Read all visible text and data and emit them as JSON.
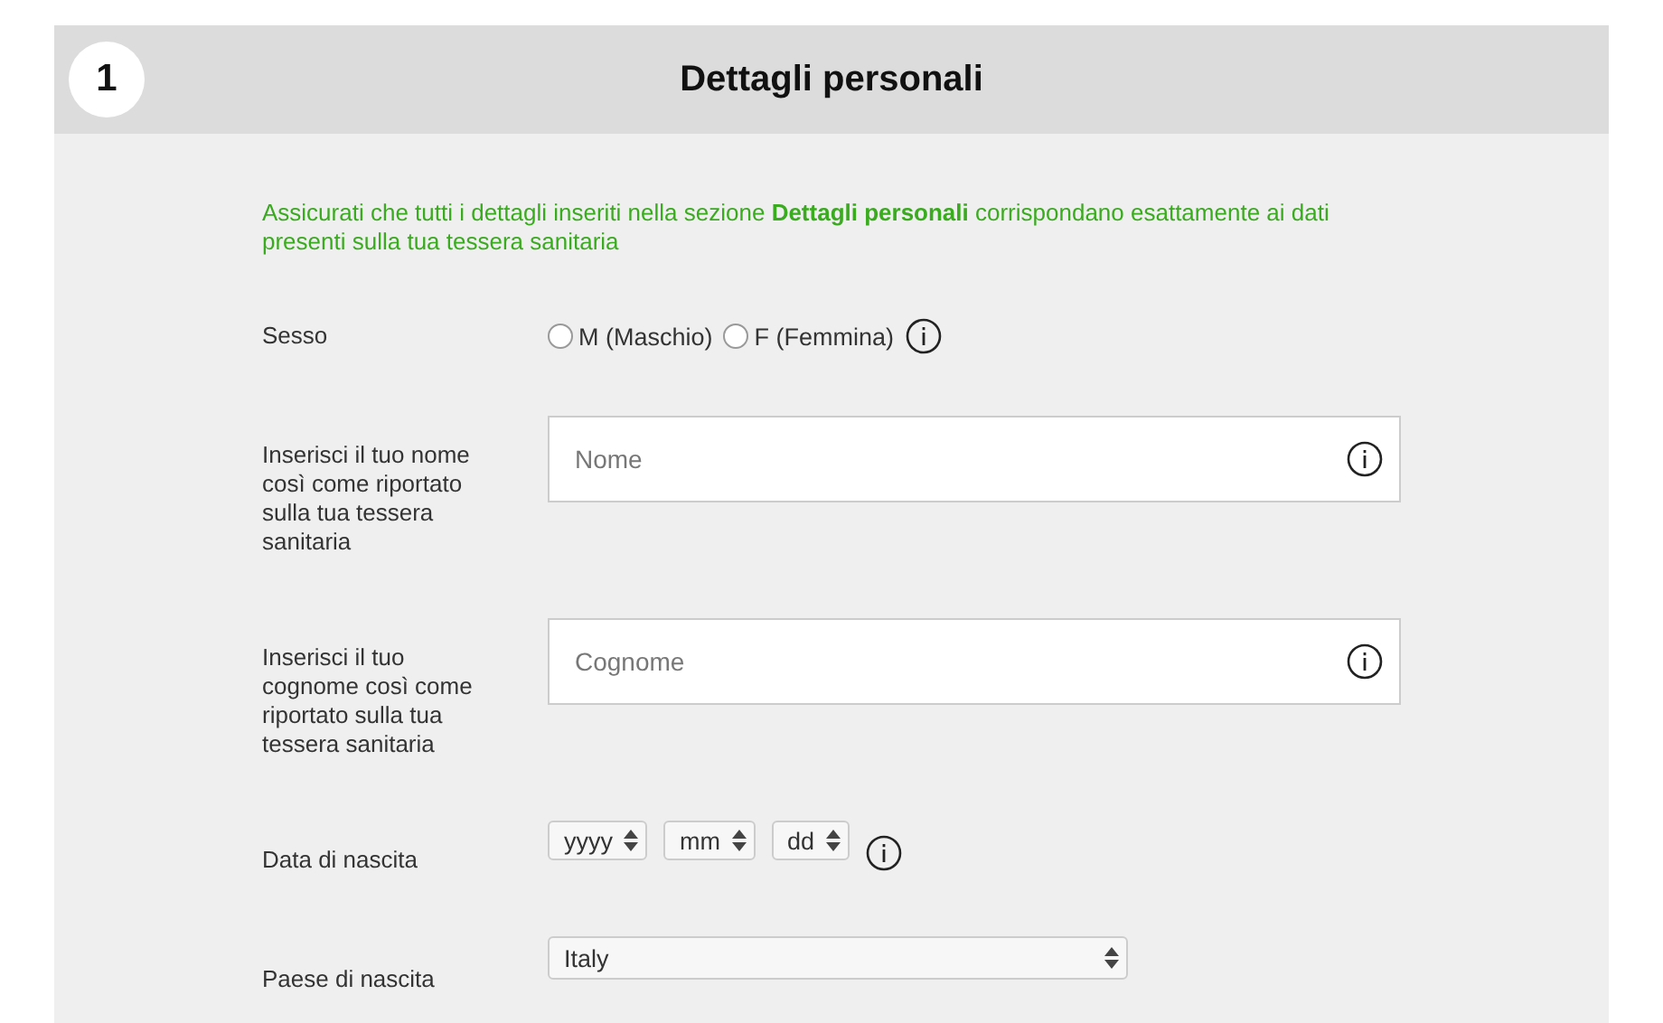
{
  "section": {
    "number": "1",
    "title": "Dettagli personali"
  },
  "notice": "Assicurati che tutti i dettagli inseriti nella sezione **Dettagli personali** corrispondano esattamente ai dati presenti sulla tua tessera sanitaria",
  "fields": [
    {
      "kind": "radio",
      "label": "Sesso",
      "info": true,
      "options": [
        {
          "label": "M (Maschio)",
          "selected": false
        },
        {
          "label": "F (Femmina)",
          "selected": false
        }
      ]
    },
    {
      "kind": "text",
      "label": "Inserisci il tuo nome così come riportato sulla tua tessera sanitaria",
      "placeholder": "Nome",
      "info": true
    },
    {
      "kind": "text",
      "label": "Inserisci il tuo cognome così come riportato sulla tua tessera sanitaria",
      "placeholder": "Cognome",
      "info": true
    },
    {
      "kind": "date",
      "label": "Data di nascita",
      "info": true,
      "parts": [
        "yyyy",
        "mm",
        "dd"
      ]
    },
    {
      "kind": "select",
      "label": "Paese di nascita",
      "info": false,
      "value": "Italy"
    }
  ]
}
